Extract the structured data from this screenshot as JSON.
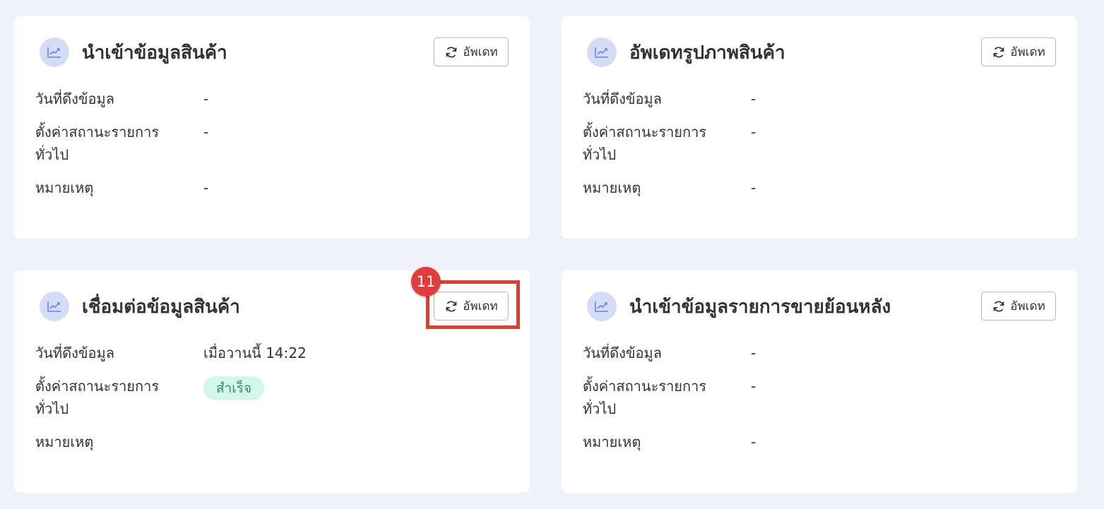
{
  "cards": [
    {
      "title": "นำเข้าข้อมูลสินค้า",
      "button_label": "อัพเดท",
      "date_label": "วันที่ดึงข้อมูล",
      "date_value": "-",
      "status_label": "ตั้งค่าสถานะรายการทั่วไป",
      "status_value": "-",
      "note_label": "หมายเหตุ",
      "note_value": "-"
    },
    {
      "title": "อัพเดทรูปภาพสินค้า",
      "button_label": "อัพเดท",
      "date_label": "วันที่ดึงข้อมูล",
      "date_value": "-",
      "status_label": "ตั้งค่าสถานะรายการทั่วไป",
      "status_value": "-",
      "note_label": "หมายเหตุ",
      "note_value": "-"
    },
    {
      "title": "เชื่อมต่อข้อมูลสินค้า",
      "button_label": "อัพเดท",
      "date_label": "วันที่ดึงข้อมูล",
      "date_value": "เมื่อวานนี้ 14:22",
      "status_label": "ตั้งค่าสถานะรายการทั่วไป",
      "status_badge": "สำเร็จ",
      "note_label": "หมายเหตุ",
      "note_value": ""
    },
    {
      "title": "นำเข้าข้อมูลรายการขายย้อนหลัง",
      "button_label": "อัพเดท",
      "date_label": "วันที่ดึงข้อมูล",
      "date_value": "-",
      "status_label": "ตั้งค่าสถานะรายการทั่วไป",
      "status_value": "-",
      "note_label": "หมายเหตุ",
      "note_value": "-"
    }
  ],
  "annotation": {
    "step_number": "11"
  },
  "icons": {
    "card_icon": "chart-line-icon",
    "button_icon": "refresh-icon"
  },
  "colors": {
    "page_background": "#eff2f9",
    "icon_badge": "#d5dcf8",
    "icon_stroke": "#6f84e6",
    "success_badge_bg": "#d4f7ec",
    "success_badge_text": "#2f8b6c",
    "highlight": "#e53935"
  }
}
